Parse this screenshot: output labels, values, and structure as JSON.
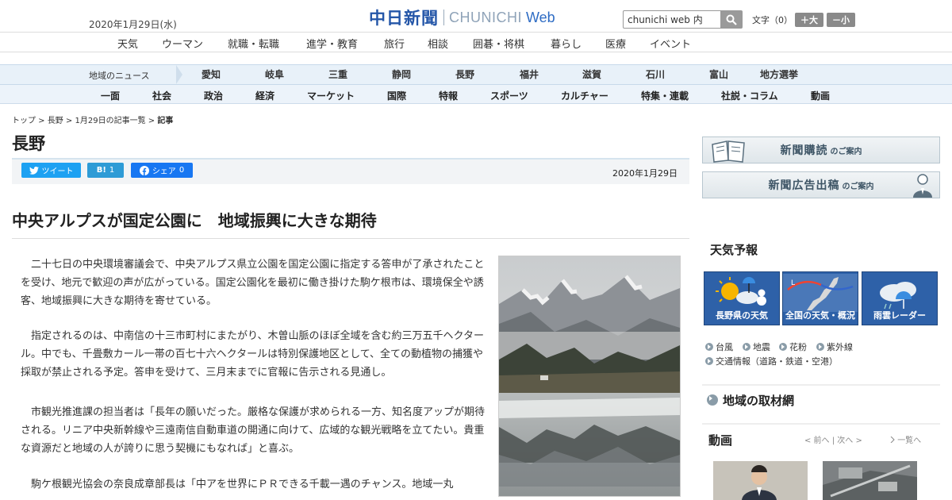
{
  "header": {
    "date": "2020年1月29日(水)",
    "logo_jp": "中日新聞",
    "logo_en": "CHUNICHI",
    "logo_web": "Web",
    "search_value": "chunichi web 内",
    "font_size_label": "文字（0）",
    "font_up": "＋大",
    "font_down": "－小"
  },
  "top_nav": [
    "天気",
    "ウーマン",
    "就職・転職",
    "進学・教育",
    "旅行",
    "相談",
    "囲碁・将棋",
    "暮らし",
    "医療",
    "イベント"
  ],
  "region_nav": {
    "label": "地域のニュース",
    "items": [
      "愛知",
      "岐阜",
      "三重",
      "静岡",
      "長野",
      "福井",
      "滋賀",
      "石川",
      "富山",
      "地方選挙"
    ]
  },
  "section_nav": [
    "一面",
    "社会",
    "政治",
    "経済",
    "マーケット",
    "国際",
    "特報",
    "スポーツ",
    "カルチャー",
    "特集・連載",
    "社説・コラム",
    "動画"
  ],
  "breadcrumb": {
    "items": [
      "トップ",
      "長野",
      "1月29日の記事一覧"
    ],
    "current": "記事"
  },
  "page_title": "長野",
  "share": {
    "tweet": "ツイート",
    "hatena": "B!",
    "hatena_count": "1",
    "facebook": "シェア",
    "facebook_count": "0"
  },
  "article": {
    "date": "2020年1月29日",
    "headline": "中央アルプスが国定公園に　地域振興に大きな期待",
    "paragraphs": [
      "二十七日の中央環境審議会で、中央アルプス県立公園を国定公園に指定する答申が了承されたことを受け、地元で歓迎の声が広がっている。国定公園化を最初に働き掛けた駒ケ根市は、環境保全や誘客、地域振興に大きな期待を寄せている。",
      "指定されるのは、中南信の十三市町村にまたがり、木曽山脈のほぼ全域を含む約三万五千ヘクタール。中でも、千畳敷カール一帯の百七十六ヘクタールは特別保護地区として、全ての動植物の捕獲や採取が禁止される予定。答申を受けて、三月末までに官報に告示される見通し。",
      "市観光推進課の担当者は「長年の願いだった。厳格な保護が求められる一方、知名度アップが期待される。リニア中央新幹線や三遠南信自動車道の開通に向けて、広域的な観光戦略を立てたい。貴重な資源だと地域の人が誇りに思う契機にもなれば」と喜ぶ。",
      "駒ケ根観光協会の奈良成章部長は「中アを世界にＰＲできる千載一遇のチャンス。地域一丸"
    ]
  },
  "sidebar": {
    "banner_subscribe": "新聞購読",
    "banner_subscribe_small": "のご案内",
    "banner_ad": "新聞広告出稿",
    "banner_ad_small": "のご案内",
    "weather_title": "天気予報",
    "weather_boxes": [
      "長野県の天気",
      "全国の天気・概況",
      "雨雲レーダー"
    ],
    "weather_links_row1": [
      "台風",
      "地震",
      "花粉",
      "紫外線"
    ],
    "weather_links_row2": [
      "交通情報（道路・鉄道・空港）"
    ],
    "region_network": "地域の取材網",
    "video_title": "動画",
    "video_prev": "< 前へ",
    "video_next": "次へ >",
    "video_list": "一覧へ"
  }
}
